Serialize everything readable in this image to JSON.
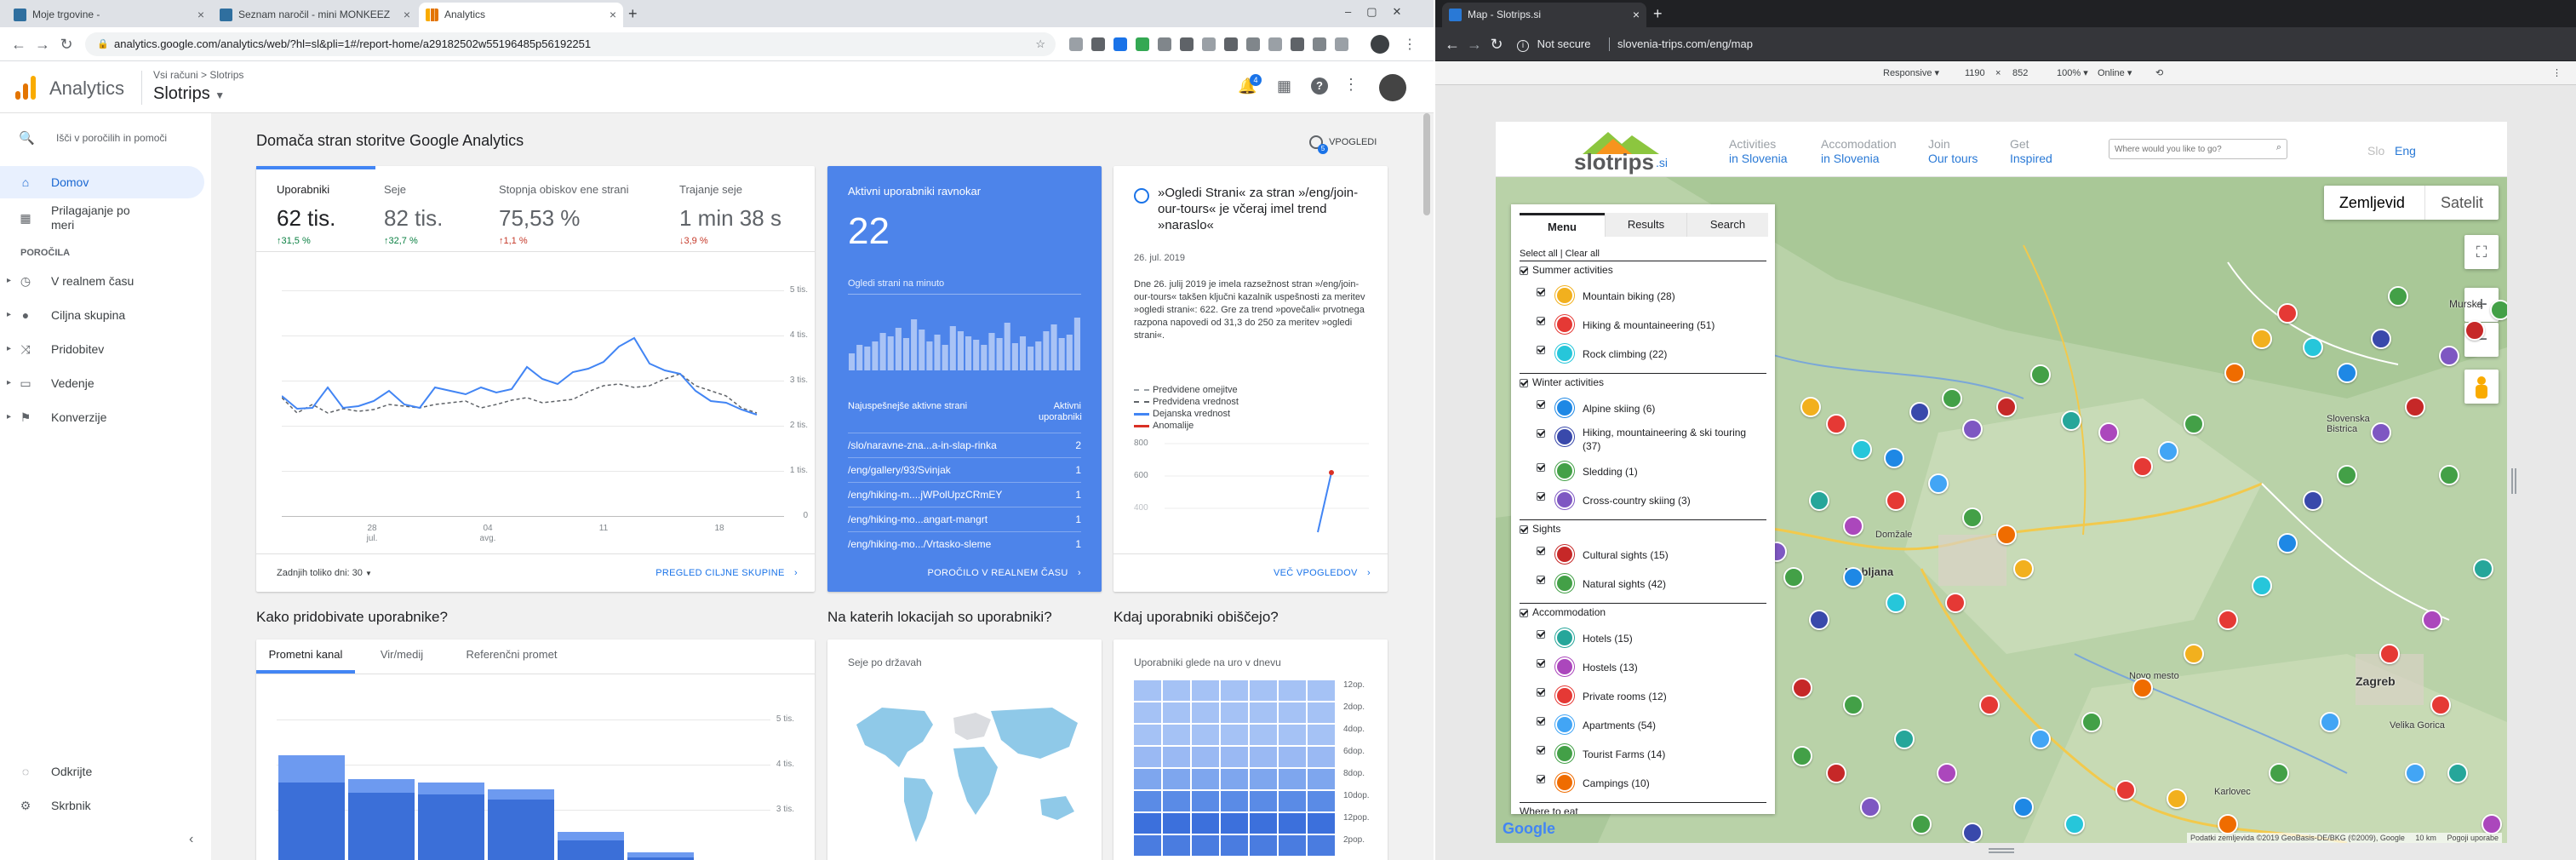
{
  "left_browser": {
    "tabs": [
      {
        "label": "Moje trgovine -"
      },
      {
        "label": "Seznam naročil - mini MONKEEZ"
      },
      {
        "label": "Analytics"
      }
    ],
    "url": "analytics.google.com/analytics/web/?hl=sl&pli=1#/report-home/a29182502w55196485p56192251"
  },
  "ga": {
    "app_name": "Analytics",
    "breadcrumb": "Vsi računi > Slotrips",
    "property": "Slotrips",
    "notification_count": "4",
    "search_label": "Išči v poročilih in pomoči",
    "nav": {
      "home": "Domov",
      "customize": "Prilagajanje po meri",
      "reports_heading": "POROČILA",
      "realtime": "V realnem času",
      "audience": "Ciljna skupina",
      "acquisition": "Pridobitev",
      "behavior": "Vedenje",
      "conversions": "Konverzije",
      "discover": "Odkrijte",
      "admin": "Skrbnik"
    },
    "page_title": "Domača stran storitve Google Analytics",
    "insights_label": "VPOGLEDI",
    "insights_badge": "5",
    "overview": {
      "metrics": [
        {
          "label": "Uporabniki",
          "value": "62 tis.",
          "change": "↑31,5 %",
          "trend": "up"
        },
        {
          "label": "Seje",
          "value": "82 tis.",
          "change": "↑32,7 %",
          "trend": "up"
        },
        {
          "label": "Stopnja obiskov ene strani",
          "value": "75,53 %",
          "change": "↑1,1 %",
          "trend": "bad"
        },
        {
          "label": "Trajanje seje",
          "value": "1 min 38 s",
          "change": "↓3,9 %",
          "trend": "bad"
        }
      ],
      "yticks": [
        "5 tis.",
        "4 tis.",
        "3 tis.",
        "2 tis.",
        "1 tis.",
        "0"
      ],
      "xticks": [
        {
          "line1": "28",
          "line2": "jul."
        },
        {
          "line1": "04",
          "line2": "avg."
        },
        {
          "line1": "11",
          "line2": ""
        },
        {
          "line1": "18",
          "line2": ""
        }
      ],
      "range_label": "Zadnjih toliko dni: 30",
      "footer_link": "PREGLED CILJNE SKUPINE"
    },
    "realtime": {
      "title": "Aktivni uporabniki ravnokar",
      "value": "22",
      "pageviews_label": "Ogledi strani na minuto",
      "table_header_left": "Najuspešnejše aktivne strani",
      "table_header_right": "Aktivni uporabniki",
      "rows": [
        {
          "page": "/slo/naravne-zna...a-in-slap-rinka",
          "users": "2"
        },
        {
          "page": "/eng/gallery/93/Svinjak",
          "users": "1"
        },
        {
          "page": "/eng/hiking-m....jWPolUpzCRmEY",
          "users": "1"
        },
        {
          "page": "/eng/hiking-mo...angart-mangrt",
          "users": "1"
        },
        {
          "page": "/eng/hiking-mo.../Vrtasko-sleme",
          "users": "1"
        }
      ],
      "footer_link": "POROČILO V REALNEM ČASU"
    },
    "insight": {
      "title": "»Ogledi Strani« za stran »/eng/join-our-tours« je včeraj imel trend »naraslo«",
      "date": "26. jul. 2019",
      "body": "Dne 26. julij 2019 je imela razsežnost stran »/eng/join-our-tours« takšen ključni kazalnik uspešnosti za meritev »ogledi strani«: 622. Gre za trend »povečali« prvotnega razpona napovedi od 31,3 do 250 za meritev »ogledi strani«.",
      "legend": [
        "Predvidene omejitve",
        "Predvidena vrednost",
        "Dejanska vrednost",
        "Anomalije"
      ],
      "yticks": [
        "800",
        "600",
        "400"
      ],
      "footer_link": "VEČ VPOGLEDOV"
    },
    "section_titles": {
      "acquisition": "Kako pridobivate uporabnike?",
      "locations": "Na katerih lokacijah so uporabniki?",
      "when": "Kdaj uporabniki obiščejo?"
    },
    "acq_tabs": [
      "Prometni kanal",
      "Vir/medij",
      "Referenčni promet"
    ],
    "acq_yticks": [
      "5 tis.",
      "4 tis.",
      "3 tis."
    ],
    "sessions_by_country": "Seje po državah",
    "users_by_hour": "Uporabniki glede na uro v dnevu",
    "hour_labels": [
      "12op.",
      "2dop.",
      "4dop.",
      "6dop.",
      "8dop.",
      "10dop.",
      "12pop.",
      "2pop."
    ]
  },
  "right_browser": {
    "tab": "Map - Slotrips.si",
    "security": "Not secure",
    "url": "slovenia-trips.com/eng/map",
    "devtools": {
      "device": "Responsive ▾",
      "width": "1190",
      "times": "×",
      "height": "852",
      "zoom": "100% ▾",
      "network": "Online ▾"
    }
  },
  "slotrips": {
    "logo_text": "slotrips",
    "logo_suffix": ".si",
    "nav": [
      {
        "line1": "Activities",
        "line2": "in Slovenia"
      },
      {
        "line1": "Accomodation",
        "line2": "in Slovenia"
      },
      {
        "line1": "Join",
        "line2": "Our tours"
      },
      {
        "line1": "Get",
        "line2": "Inspired"
      }
    ],
    "search_placeholder": "Where would you like to go?",
    "lang_slo": "Slo",
    "lang_eng": "Eng",
    "map_type": {
      "map": "Zemljevid",
      "satellite": "Satelit"
    },
    "panel_tabs": [
      "Menu",
      "Results",
      "Search"
    ],
    "select_all": "Select all | Clear all",
    "categories": [
      {
        "name": "Summer activities",
        "items": [
          {
            "label": "Mountain biking (28)",
            "color": "#f2b01e",
            "icon": "bike-icon"
          },
          {
            "label": "Hiking & mountaineering (51)",
            "color": "#e53935",
            "icon": "hiker-icon"
          },
          {
            "label": "Rock climbing (22)",
            "color": "#26c6da",
            "icon": "climber-icon"
          }
        ]
      },
      {
        "name": "Winter activities",
        "items": [
          {
            "label": "Alpine skiing (6)",
            "color": "#1e88e5",
            "icon": "skier-icon"
          },
          {
            "label": "Hiking, mountaineering & ski touring (37)",
            "color": "#3949ab",
            "icon": "skitouring-icon"
          },
          {
            "label": "Sledding (1)",
            "color": "#43a047",
            "icon": "sled-icon"
          },
          {
            "label": "Cross-country skiing (3)",
            "color": "#7e57c2",
            "icon": "crosscountry-icon"
          }
        ]
      },
      {
        "name": "Sights",
        "items": [
          {
            "label": "Cultural sights (15)",
            "color": "#c62828",
            "icon": "museum-icon"
          },
          {
            "label": "Natural sights (42)",
            "color": "#43a047",
            "icon": "tree-icon"
          }
        ]
      },
      {
        "name": "Accommodation",
        "items": [
          {
            "label": "Hotels (15)",
            "color": "#26a69a",
            "icon": "hotel-icon"
          },
          {
            "label": "Hostels (13)",
            "color": "#ab47bc",
            "icon": "hostel-icon"
          },
          {
            "label": "Private rooms (12)",
            "color": "#e53935",
            "icon": "bed-icon"
          },
          {
            "label": "Apartments (54)",
            "color": "#42a5f5",
            "icon": "apartment-icon"
          },
          {
            "label": "Tourist Farms (14)",
            "color": "#43a047",
            "icon": "farm-icon"
          },
          {
            "label": "Campings (10)",
            "color": "#ef6c00",
            "icon": "tent-icon"
          }
        ]
      }
    ],
    "next_category": "Where to eat",
    "map_labels": [
      "Murska",
      "Slovenska Bistrica",
      "Domžale",
      "Ljubljana",
      "Zagreb",
      "Velika Gorica",
      "Novo mesto",
      "Karlovec"
    ],
    "google": "Google",
    "attribution": "Podatki zemljevida ©2019 GeoBasis-DE/BKG (©2009), Google",
    "scale": "10 km",
    "report": "Pogoji uporabe"
  },
  "colors": {
    "ga_blue": "#4285f4",
    "ga_orange": "#f4b400",
    "slotrips_blue": "#2979d6"
  }
}
